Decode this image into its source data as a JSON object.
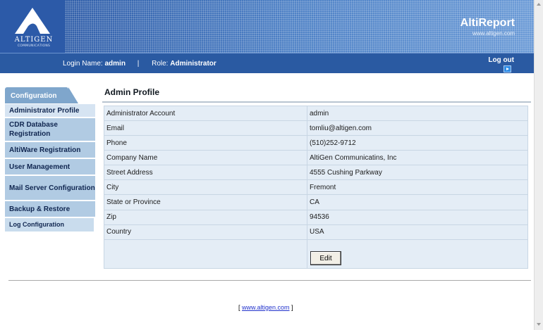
{
  "header": {
    "logo_text": "ALTIGEN",
    "logo_subtext": "COMMUNICATIONS",
    "app_name": "AltiReport",
    "app_url": "www.altigen.com"
  },
  "login_bar": {
    "login_label": "Login Name:",
    "login_value": "admin",
    "separator": "|",
    "role_label": "Role:",
    "role_value": "Administrator",
    "logout_label": "Log out"
  },
  "sidebar": {
    "tab_label": "Configuration",
    "items": [
      {
        "label": "Administrator Profile"
      },
      {
        "label": "CDR Database Registration"
      },
      {
        "label": "AltiWare Registration"
      },
      {
        "label": "User Management"
      },
      {
        "label": "Mail Server Configuration"
      },
      {
        "label": "Backup & Restore"
      },
      {
        "label": "Log Configuration"
      }
    ]
  },
  "main": {
    "title": "Admin Profile",
    "rows": [
      {
        "label": "Administrator Account",
        "value": "admin"
      },
      {
        "label": "Email",
        "value": "tomliu@altigen.com"
      },
      {
        "label": "Phone",
        "value": "(510)252-9712"
      },
      {
        "label": "Company Name",
        "value": "AltiGen Communicatins, Inc"
      },
      {
        "label": "Street Address",
        "value": "4555 Cushing Parkway"
      },
      {
        "label": "City",
        "value": "Fremont"
      },
      {
        "label": "State or Province",
        "value": "CA"
      },
      {
        "label": "Zip",
        "value": "94536"
      },
      {
        "label": "Country",
        "value": "USA"
      }
    ],
    "edit_label": "Edit"
  },
  "footer": {
    "bracket_open": "[",
    "link_text": "www.altigen.com",
    "bracket_close": "]"
  },
  "colors": {
    "banner_blue": "#3d6fb8",
    "login_bar_blue": "#2a5aa2",
    "sidebar_item": "#b1cbe3",
    "table_bg": "#e4edf6"
  }
}
